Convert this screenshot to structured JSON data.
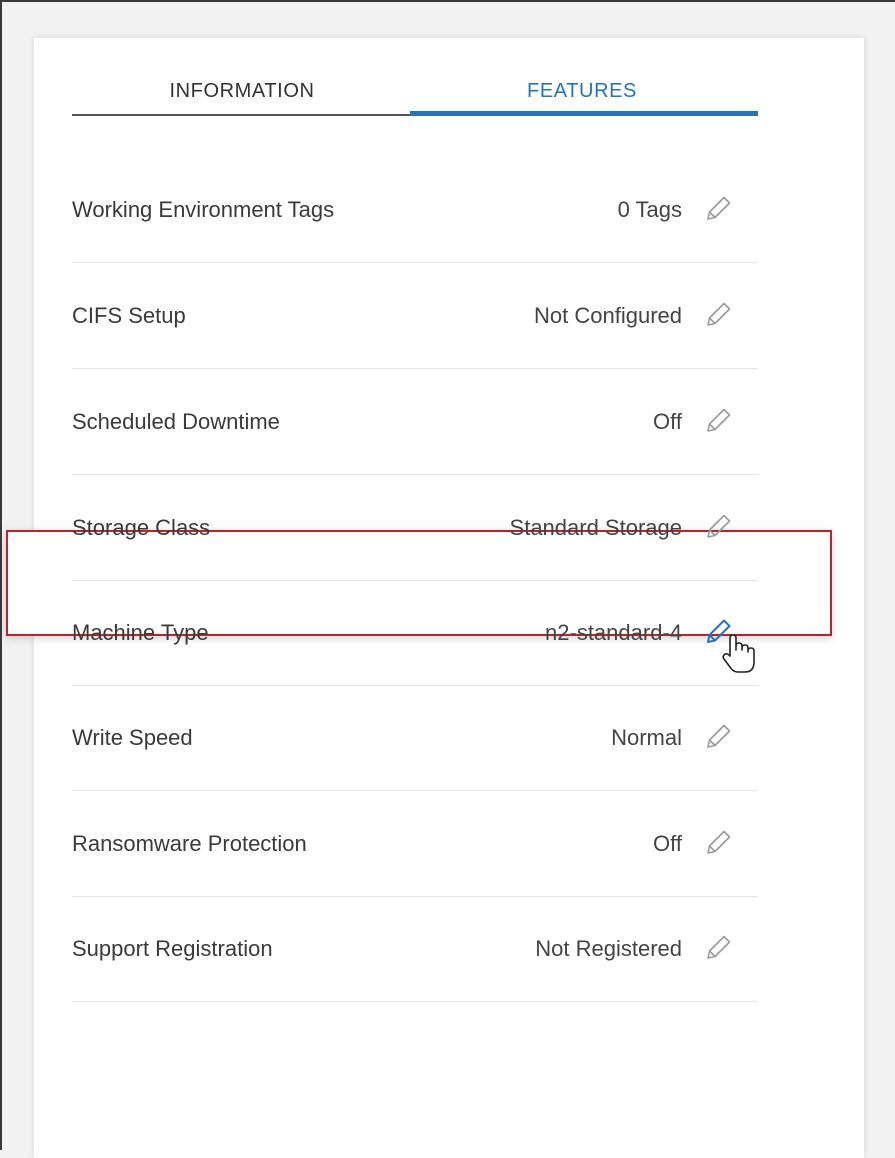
{
  "tabs": [
    {
      "label": "INFORMATION",
      "active": false
    },
    {
      "label": "FEATURES",
      "active": true
    }
  ],
  "features": [
    {
      "label": "Working Environment Tags",
      "value": "0 Tags",
      "icon": "pencil-icon"
    },
    {
      "label": "CIFS Setup",
      "value": "Not Configured",
      "icon": "pencil-icon"
    },
    {
      "label": "Scheduled Downtime",
      "value": "Off",
      "icon": "pencil-icon"
    },
    {
      "label": "Storage Class",
      "value": "Standard Storage",
      "icon": "pencil-icon"
    },
    {
      "label": "Machine Type",
      "value": "n2-standard-4",
      "icon": "pencil-icon",
      "highlighted": true
    },
    {
      "label": "Write Speed",
      "value": "Normal",
      "icon": "pencil-icon"
    },
    {
      "label": "Ransomware Protection",
      "value": "Off",
      "icon": "pencil-icon"
    },
    {
      "label": "Support Registration",
      "value": "Not Registered",
      "icon": "pencil-icon"
    }
  ],
  "colors": {
    "accent": "#2a72b8",
    "highlight_border": "#b5252a",
    "icon_gray": "#9a9a9a"
  },
  "cursor": "hand-pointer-icon"
}
